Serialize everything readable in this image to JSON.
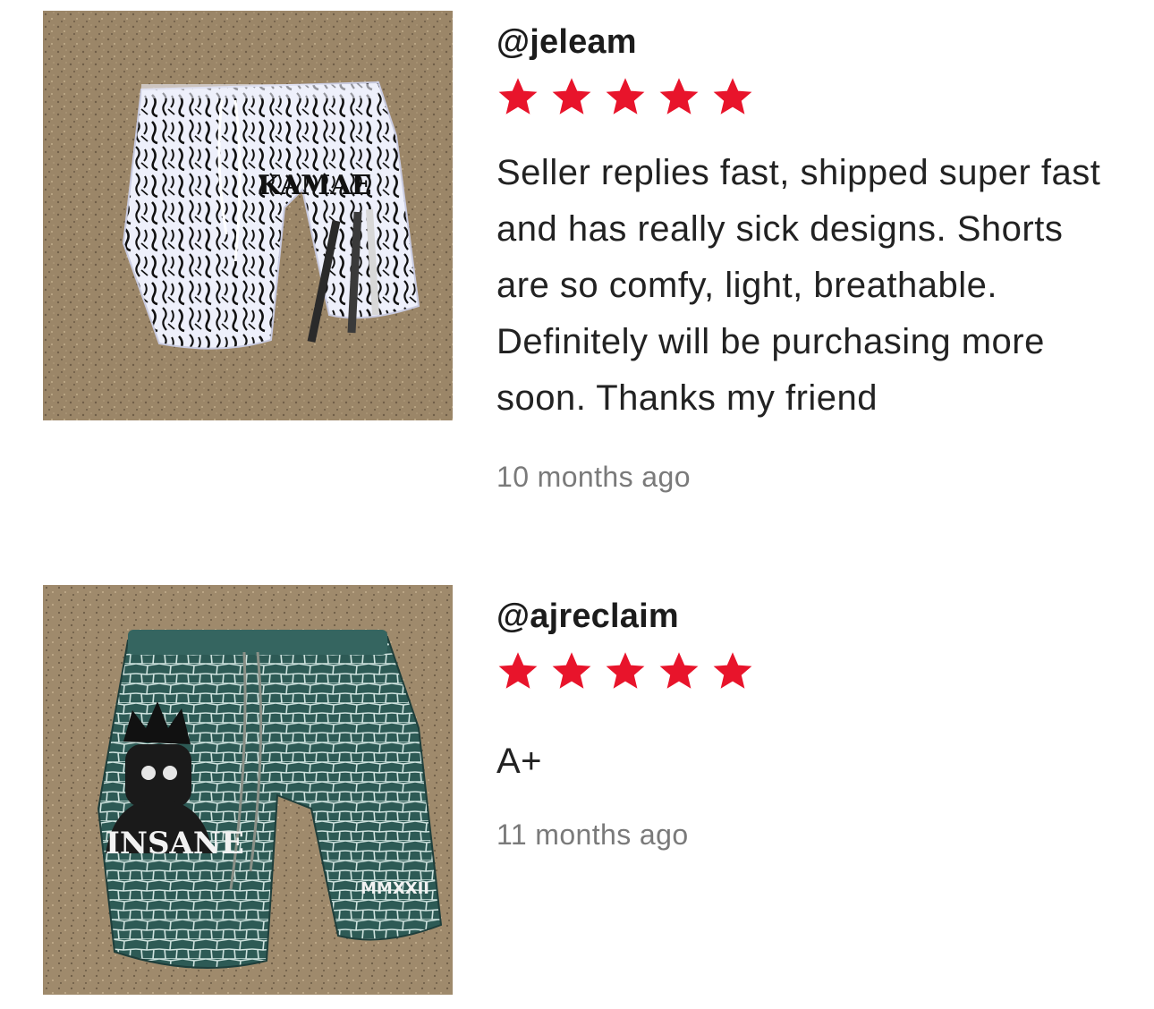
{
  "reviews": [
    {
      "username": "@jeleam",
      "rating": 5,
      "text": "Seller replies fast, shipped super fast and has really sick designs. Shorts are so comfy, light, breathable. Definitely will be purchasing more soon. Thanks my friend",
      "time": "10 months ago",
      "photo": {
        "description_icon": "white-zebra-print-shorts-photo",
        "print_text": "KAMAE"
      }
    },
    {
      "username": "@ajreclaim",
      "rating": 5,
      "text": "A+",
      "time": "11 months ago",
      "photo": {
        "description_icon": "green-croc-print-shorts-photo",
        "print_text": "INSANE",
        "print_text_2": "MMXXII"
      }
    }
  ],
  "colors": {
    "star": "#e8142b",
    "ground": "#9a8468",
    "time_text": "#7a7a7a"
  }
}
